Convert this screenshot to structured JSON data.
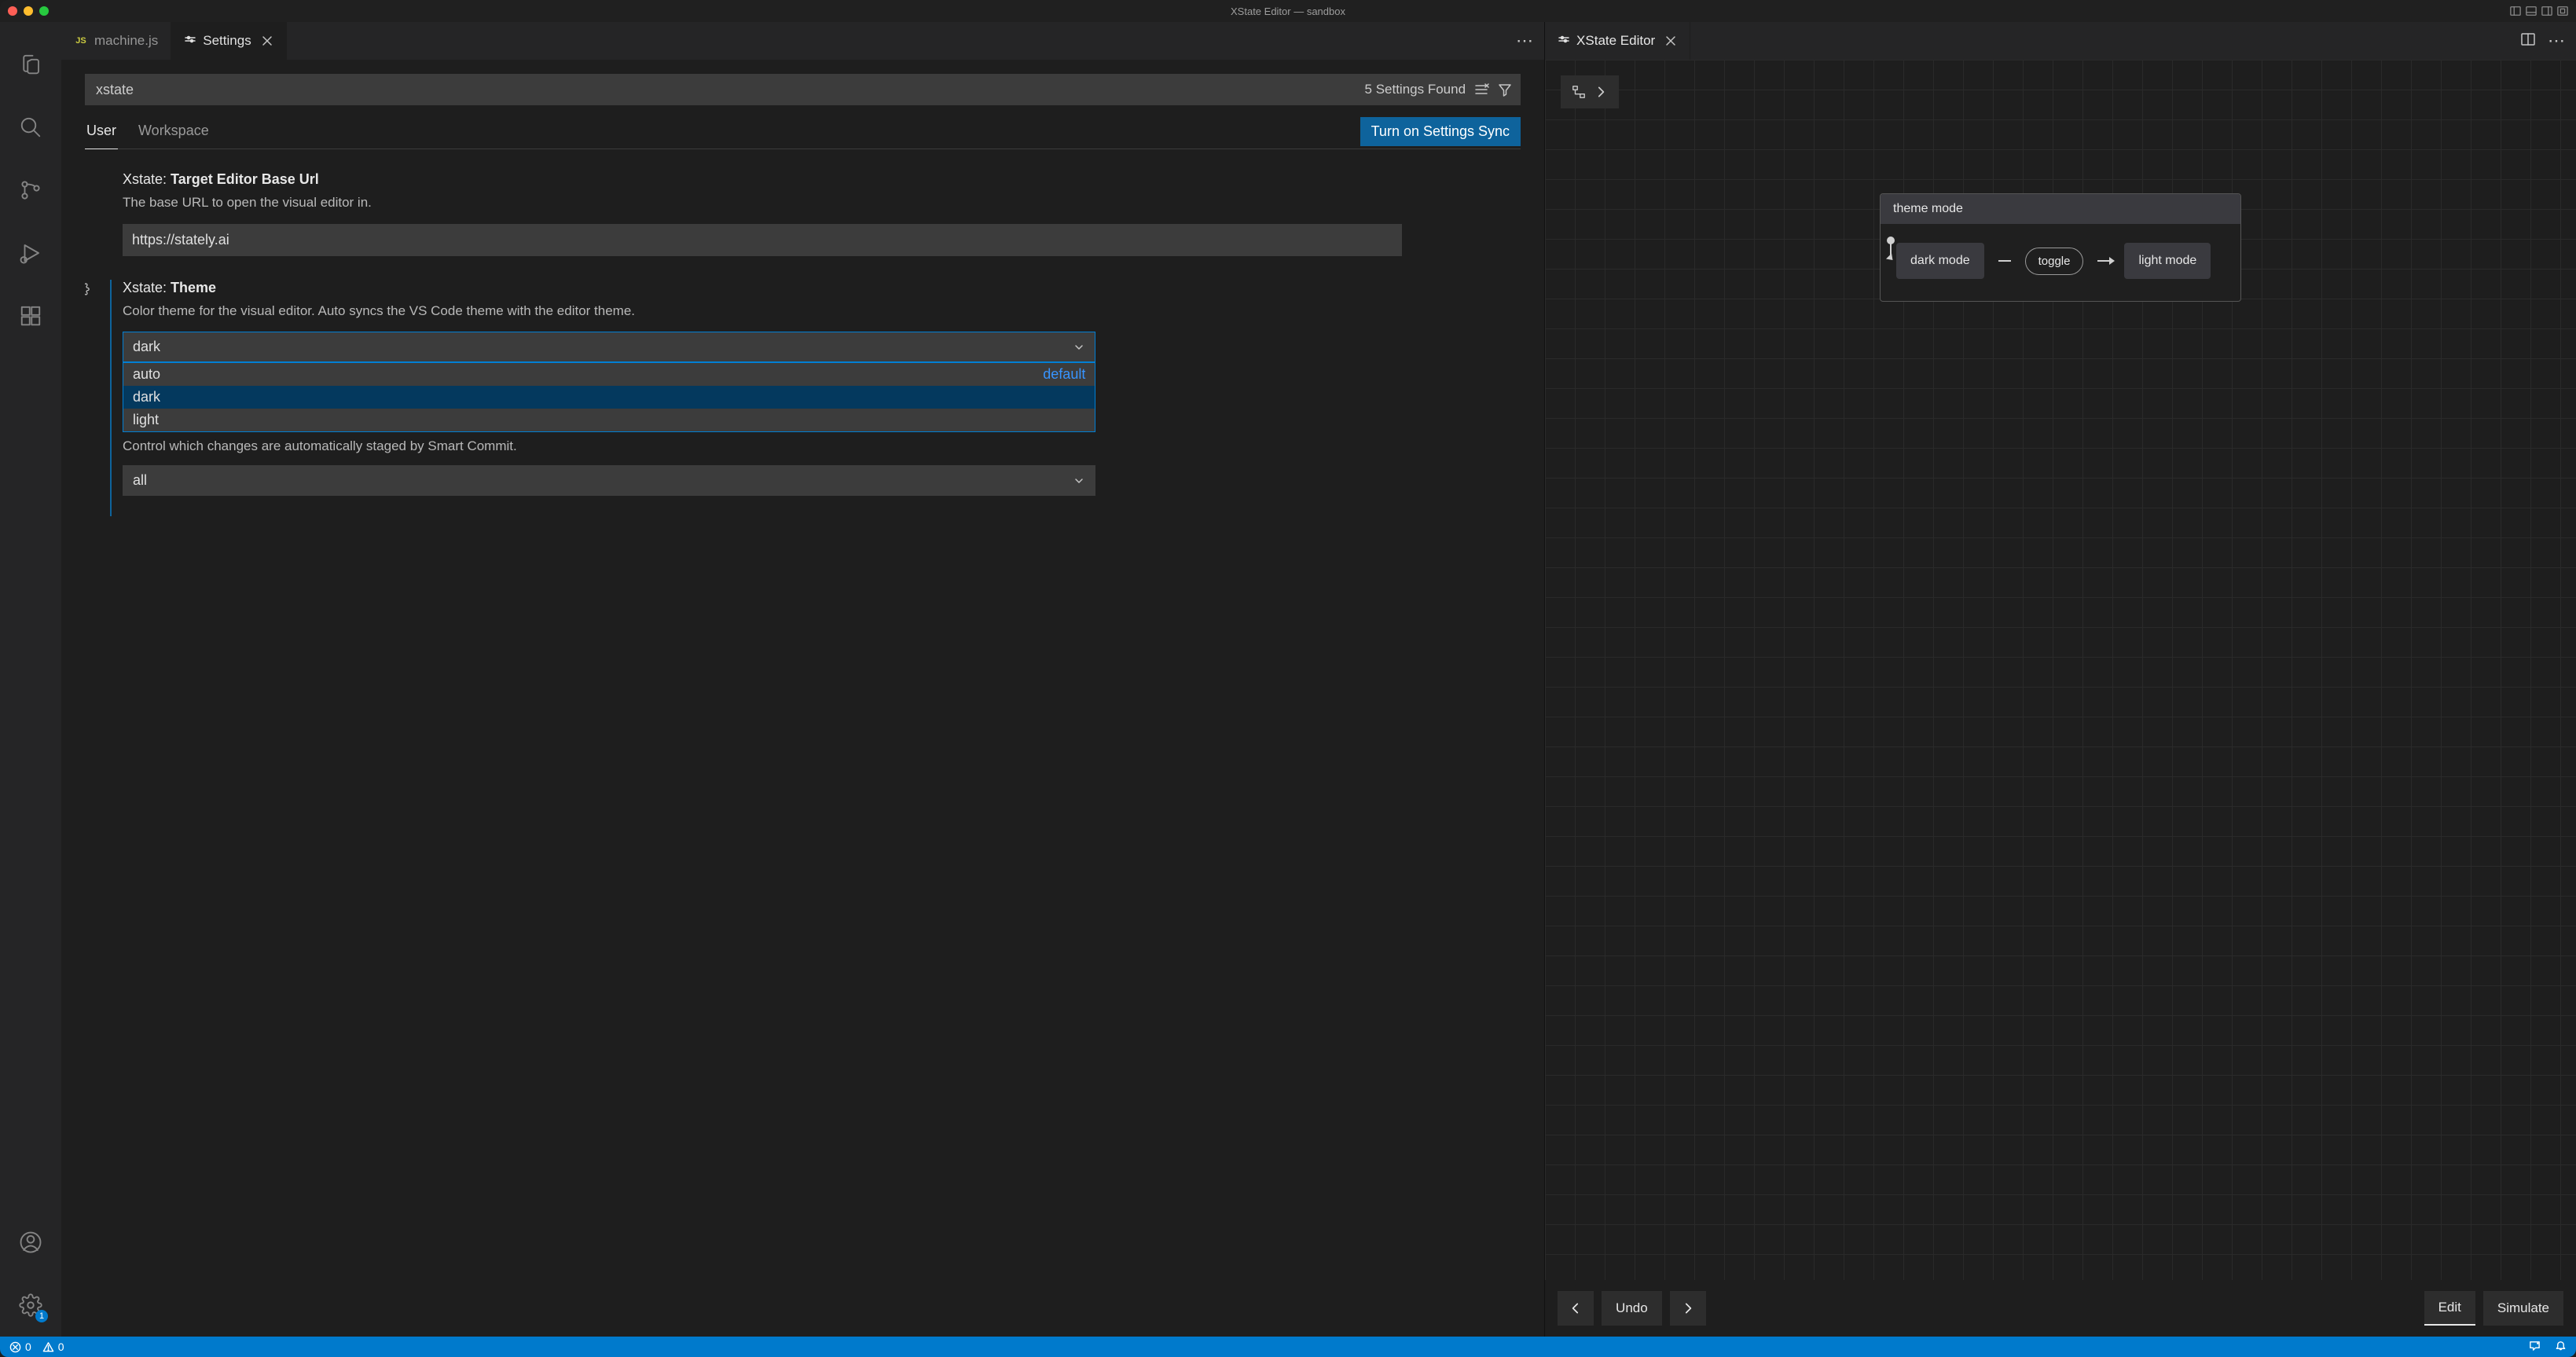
{
  "titlebar": {
    "title": "XState Editor — sandbox"
  },
  "tabs": {
    "left": [
      {
        "label": "machine.js",
        "lang": "JS",
        "active": false
      },
      {
        "label": "Settings",
        "lang": "gear",
        "active": true
      }
    ],
    "right": {
      "label": "XState Editor"
    }
  },
  "settings": {
    "search": {
      "value": "xstate",
      "found": "5 Settings Found"
    },
    "scope": {
      "user": "User",
      "workspace": "Workspace"
    },
    "sync": "Turn on Settings Sync",
    "items": {
      "baseUrl": {
        "prefix": "Xstate: ",
        "title": "Target Editor Base Url",
        "desc": "The base URL to open the visual editor in.",
        "value": "https://stately.ai"
      },
      "theme": {
        "prefix": "Xstate: ",
        "title": "Theme",
        "desc": "Color theme for the visual editor. Auto syncs the VS Code theme with the editor theme.",
        "value": "dark",
        "options": [
          {
            "label": "auto",
            "default": "default",
            "selected": false
          },
          {
            "label": "dark",
            "selected": true
          },
          {
            "label": "light",
            "selected": false
          }
        ]
      },
      "smartCommit": {
        "desc": "Control which changes are automatically staged by Smart Commit.",
        "value": "all"
      }
    }
  },
  "xstate": {
    "machine": {
      "name": "theme mode",
      "state1": "dark mode",
      "event": "toggle",
      "state2": "light mode"
    },
    "toolbar": {
      "undo": "Undo",
      "edit": "Edit",
      "simulate": "Simulate"
    }
  },
  "statusbar": {
    "errors": "0",
    "warnings": "0"
  },
  "activitybar": {
    "settingsBadge": "1"
  }
}
